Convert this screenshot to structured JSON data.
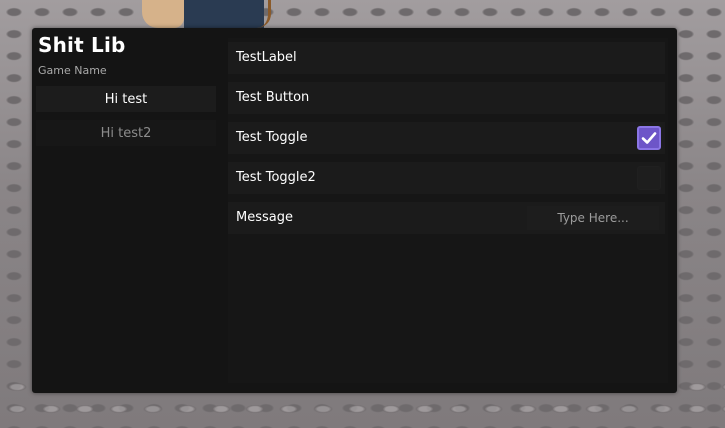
{
  "window": {
    "title": "Shit Lib",
    "subtitle": "Game Name",
    "accent_color": "#6d55c8",
    "background_color": "#141414"
  },
  "tabs": [
    {
      "label": "Hi test",
      "active": true
    },
    {
      "label": "Hi test2",
      "active": false
    }
  ],
  "elements": {
    "label": {
      "text": "TestLabel"
    },
    "button": {
      "label": "Test Button"
    },
    "toggle1": {
      "label": "Test Toggle",
      "checked": true,
      "icon": "checkmark-icon"
    },
    "toggle2": {
      "label": "Test Toggle2",
      "checked": false
    },
    "message": {
      "label": "Message",
      "placeholder": "Type Here...",
      "value": ""
    }
  }
}
